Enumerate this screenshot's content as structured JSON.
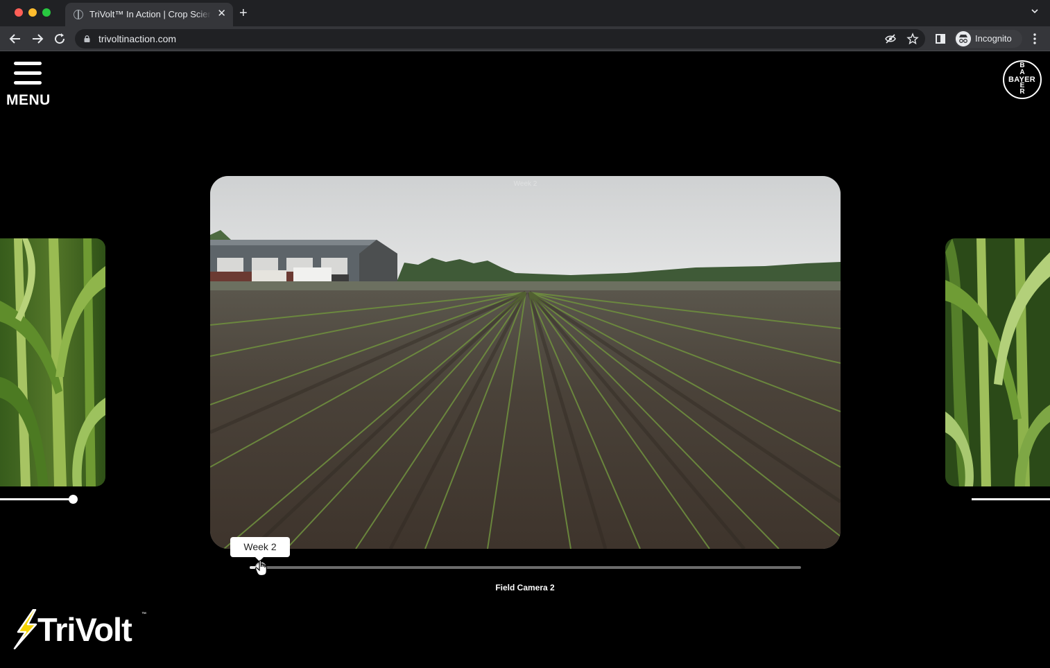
{
  "browser": {
    "tab_title": "TriVolt™ In Action | Crop Science",
    "url": "trivoltinaction.com",
    "profile_label": "Incognito",
    "tab_close": "✕",
    "new_tab": "+"
  },
  "page": {
    "menu_label": "MENU",
    "bayer_logo_h": "BAYER",
    "bayer_logo_v": [
      "B",
      "A",
      "Y",
      "E",
      "R"
    ],
    "main_watermark": "Week 2",
    "week_tooltip": "Week 2",
    "camera_label": "Field Camera 2",
    "brand_logo": "TriVolt",
    "brand_tm": "™",
    "timeline_progress": 0.02,
    "left_card_slider_progress": 1.0,
    "right_card_slider_progress": 0.0
  },
  "colors": {
    "background": "#000000",
    "chrome_dark": "#202124",
    "chrome_toolbar": "#35363a",
    "accent_yellow": "#f5d300"
  },
  "icons": {
    "back": "arrow-left-icon",
    "forward": "arrow-right-icon",
    "reload": "reload-icon",
    "lock": "lock-icon",
    "eye_off": "eye-off-icon",
    "star": "star-icon",
    "side_panel": "side-panel-icon",
    "kebab": "more-vert-icon",
    "menu": "hamburger-icon"
  }
}
